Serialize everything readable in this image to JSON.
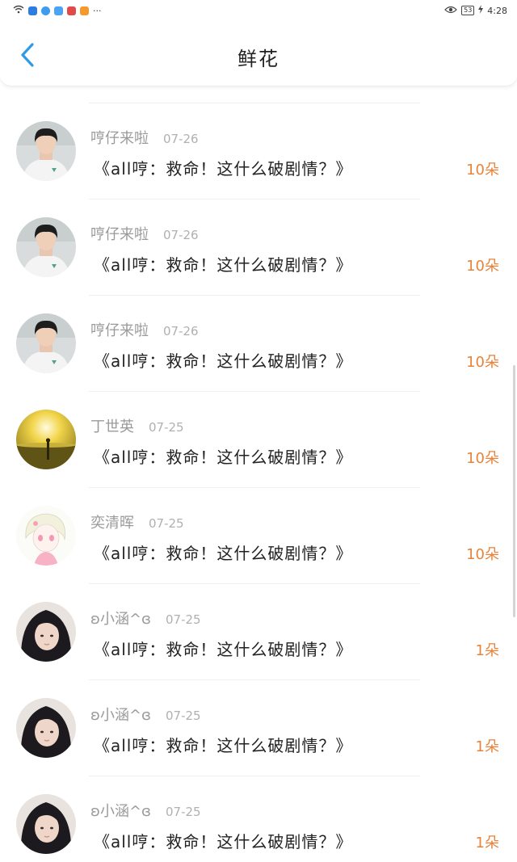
{
  "status_bar": {
    "time": "4:28",
    "battery": "53",
    "overflow_dots": "···"
  },
  "header": {
    "title": "鲜花"
  },
  "colors": {
    "accent_back": "#2f9be6",
    "count_orange": "#e8833a"
  },
  "rows": [
    {
      "user": "哼仔来啦",
      "date": "07-26",
      "message": "《all哼：救命！这什么破剧情？》",
      "count": "10朵",
      "avatar": "boy"
    },
    {
      "user": "哼仔来啦",
      "date": "07-26",
      "message": "《all哼：救命！这什么破剧情？》",
      "count": "10朵",
      "avatar": "boy"
    },
    {
      "user": "哼仔来啦",
      "date": "07-26",
      "message": "《all哼：救命！这什么破剧情？》",
      "count": "10朵",
      "avatar": "boy"
    },
    {
      "user": "丁世英",
      "date": "07-25",
      "message": "《all哼：救命！这什么破剧情？》",
      "count": "10朵",
      "avatar": "sunset"
    },
    {
      "user": "奕清晖",
      "date": "07-25",
      "message": "《all哼：救命！这什么破剧情？》",
      "count": "10朵",
      "avatar": "anime"
    },
    {
      "user": "ʚ小涵^ɞ",
      "date": "07-25",
      "message": "《all哼：救命！这什么破剧情？》",
      "count": "1朵",
      "avatar": "girl"
    },
    {
      "user": "ʚ小涵^ɞ",
      "date": "07-25",
      "message": "《all哼：救命！这什么破剧情？》",
      "count": "1朵",
      "avatar": "girl"
    },
    {
      "user": "ʚ小涵^ɞ",
      "date": "07-25",
      "message": "《all哼：救命！这什么破剧情？》",
      "count": "1朵",
      "avatar": "girl"
    }
  ]
}
